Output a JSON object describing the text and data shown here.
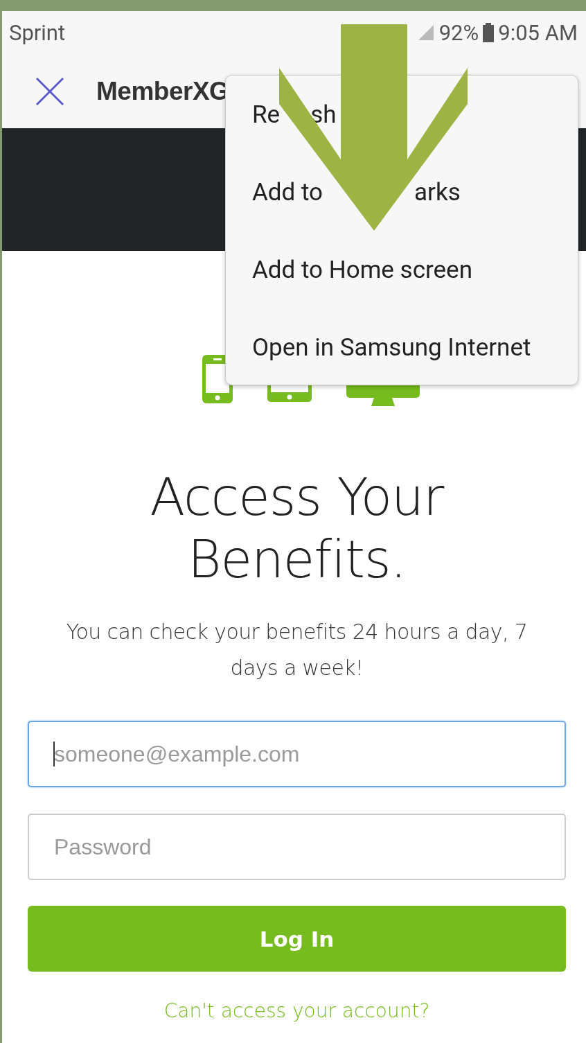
{
  "status_bar": {
    "carrier": "Sprint",
    "battery": "92%",
    "time": "9:05 AM"
  },
  "toolbar": {
    "title": "MemberXG"
  },
  "menu": {
    "items": [
      {
        "parts": [
          "Re",
          "sh"
        ]
      },
      {
        "parts": [
          "Add to",
          "arks"
        ]
      },
      {
        "parts": [
          "Add to Home screen"
        ]
      },
      {
        "parts": [
          "Open in Samsung Internet"
        ]
      }
    ]
  },
  "login": {
    "heading": "Access Your Benefits.",
    "subtitle": "You can check your benefits 24 hours a day, 7 days a week!",
    "email": {
      "placeholder": "someone@example.com",
      "focused": true
    },
    "password": {
      "placeholder": "Password",
      "focused": false
    },
    "button": "Log In",
    "link": "Can't access your account?"
  }
}
